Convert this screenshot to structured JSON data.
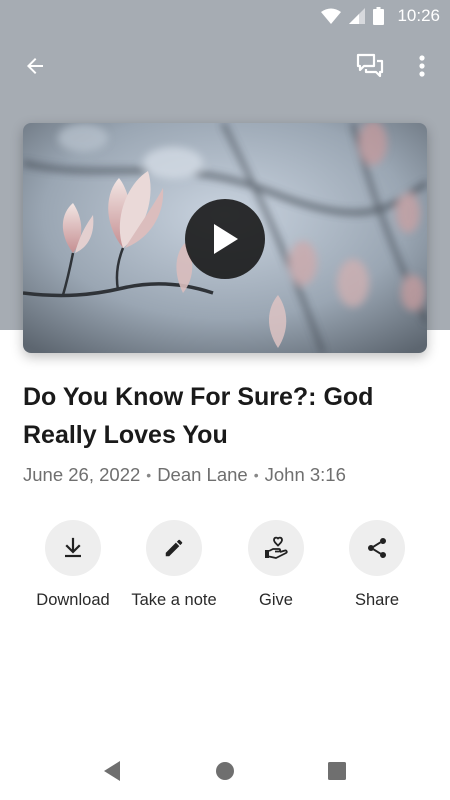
{
  "status_bar": {
    "time": "10:26",
    "icons": [
      "wifi-icon",
      "signal-icon",
      "battery-icon"
    ]
  },
  "app_bar": {
    "icons": [
      "back-arrow-icon",
      "chat-icon",
      "more-vert-icon"
    ]
  },
  "hero": {
    "image": "magnolia-blossoms",
    "play_icon": "play-icon"
  },
  "sermon": {
    "title": "Do You Know For Sure?: God Really Loves You",
    "date": "June 26, 2022",
    "speaker": "Dean Lane",
    "reference": "John 3:16",
    "separator": "•"
  },
  "actions": [
    {
      "label": "Download",
      "icon": "download-icon"
    },
    {
      "label": "Take a note",
      "icon": "pencil-icon"
    },
    {
      "label": "Give",
      "icon": "give-heart-hand-icon"
    },
    {
      "label": "Share",
      "icon": "share-icon"
    }
  ],
  "nav_bar": {
    "icons": [
      "nav-back-icon",
      "nav-home-icon",
      "nav-recents-icon"
    ]
  },
  "colors": {
    "header": "#a6acb3",
    "text": "#1a1a1a",
    "meta": "#6f6f6f",
    "action_bg": "#eeeeee"
  }
}
